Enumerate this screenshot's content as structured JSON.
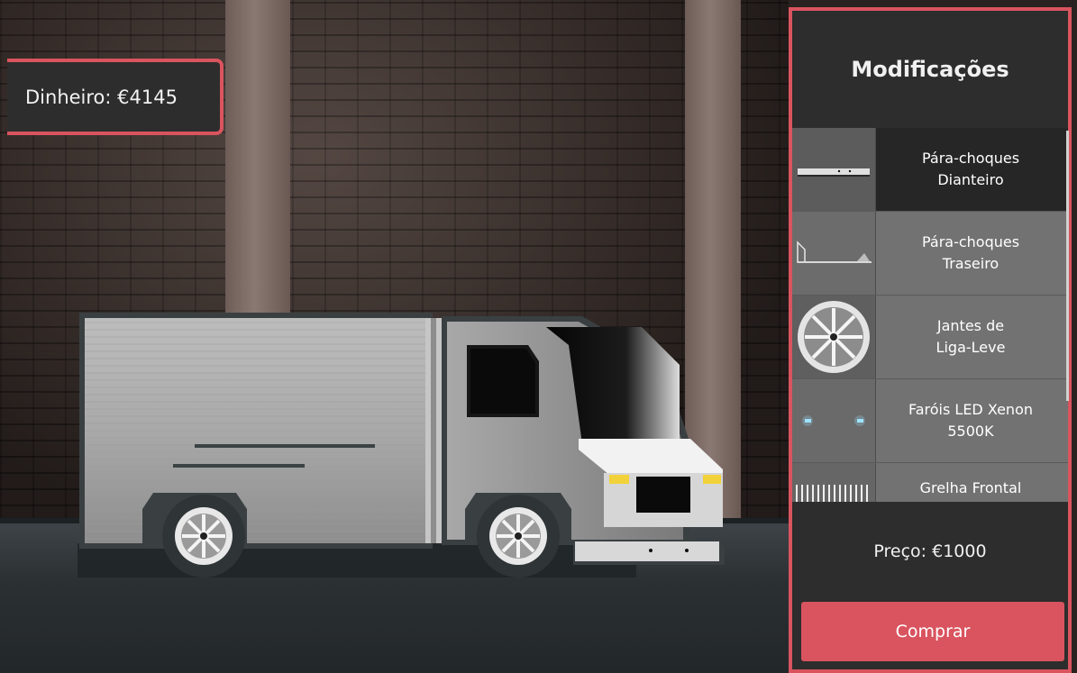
{
  "hud": {
    "money_text": "Dinheiro: €4145"
  },
  "panel": {
    "title": "Modificações",
    "selected_index": 0,
    "items": [
      {
        "label": "Pára-choques\nDianteiro",
        "icon": "front-bumper-icon"
      },
      {
        "label": "Pára-choques\nTraseiro",
        "icon": "rear-bumper-icon"
      },
      {
        "label": "Jantes de\nLiga-Leve",
        "icon": "alloy-wheel-icon"
      },
      {
        "label": "Faróis LED Xenon\n5500K",
        "icon": "xenon-headlights-icon"
      },
      {
        "label": "Grelha Frontal",
        "icon": "front-grille-icon"
      }
    ],
    "price_text": "Preço: €1000",
    "buy_label": "Comprar"
  },
  "colors": {
    "accent": "#d9545f",
    "panel_bg": "#2d2d2d",
    "item_bg": "#727272",
    "item_selected_bg": "#262626"
  }
}
